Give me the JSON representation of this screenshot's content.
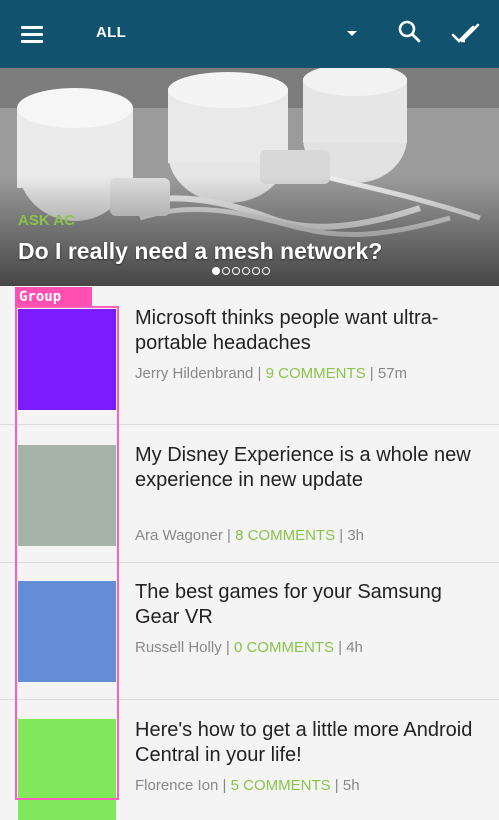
{
  "appbar": {
    "filter_label": "ALL"
  },
  "hero": {
    "kicker": "ASK AC",
    "headline": "Do I really need a mesh network?",
    "pages": 6,
    "current_page": 1
  },
  "group_label": "Group",
  "articles": [
    {
      "title": "Microsoft thinks people want ultra-portable headaches",
      "author": "Jerry Hildenbrand",
      "comments": "9 COMMENTS",
      "age": "57m",
      "thumb_color": "#7b1cff"
    },
    {
      "title": "My Disney Experience is a whole new experience in new update",
      "author": "Ara Wagoner",
      "comments": "8 COMMENTS",
      "age": "3h",
      "thumb_color": "#a6b3a9"
    },
    {
      "title": "The best games for your Samsung Gear VR",
      "author": "Russell Holly",
      "comments": "0 COMMENTS",
      "age": "4h",
      "thumb_color": "#638ed6"
    },
    {
      "title": "Here's how to get a little more Android Central in your life!",
      "author": "Florence Ion",
      "comments": "5 COMMENTS",
      "age": "5h",
      "thumb_color": "#7fe95b"
    }
  ],
  "colors": {
    "appbar": "#11536f",
    "accent": "#8bc34a",
    "group_outline": "#ff5fb7"
  }
}
